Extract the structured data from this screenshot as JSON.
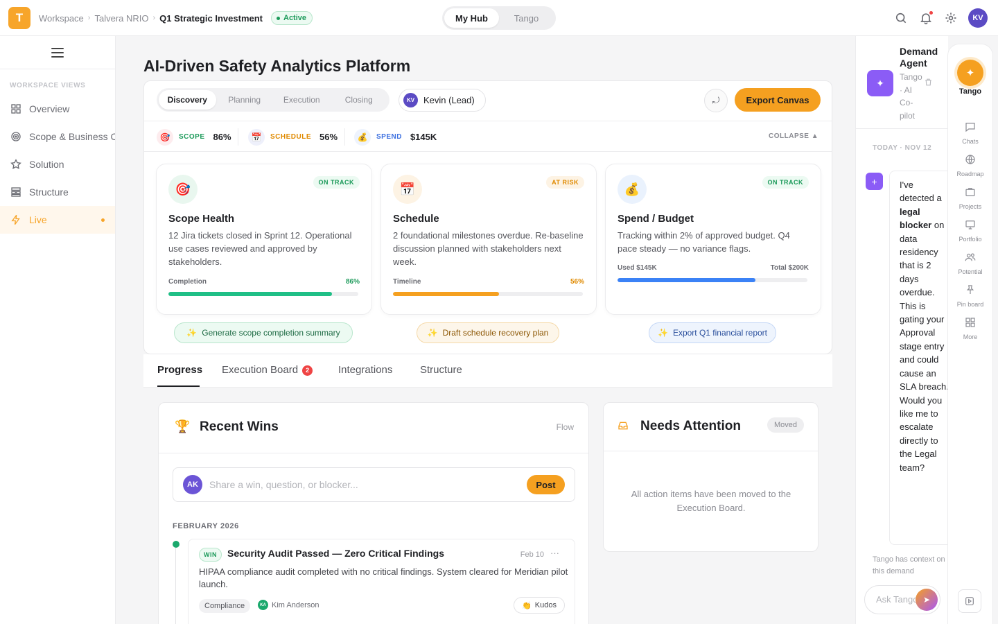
{
  "app": {
    "logo_letter": "T",
    "accent": "#f5a020"
  },
  "breadcrumb": {
    "items": [
      "Workspace",
      "Talvera NRIO"
    ],
    "current": "Q1 Strategic Investment",
    "status": "Active"
  },
  "hub": {
    "tabs": [
      "My Hub",
      "Tango"
    ],
    "active": "My Hub"
  },
  "topbar": {
    "icons": [
      "search-icon",
      "bell-icon",
      "gear-icon"
    ],
    "user_initials": "KV"
  },
  "sidebar": {
    "heading": "WORKSPACE VIEWS",
    "items": [
      {
        "label": "Overview",
        "icon": "grid-icon"
      },
      {
        "label": "Scope & Business Case",
        "icon": "target-icon"
      },
      {
        "label": "Solution",
        "icon": "star-icon"
      },
      {
        "label": "Structure",
        "icon": "structure-icon"
      },
      {
        "label": "Live",
        "icon": "bolt-icon",
        "active": true
      }
    ]
  },
  "main": {
    "title": "AI-Driven Safety Analytics Platform",
    "phases": [
      "Discovery",
      "Planning",
      "Execution",
      "Closing"
    ],
    "active_phase": "Discovery",
    "lead": {
      "initials": "KV",
      "label": "Kevin (Lead)"
    },
    "export_label": "Export Canvas",
    "collapse_label": "COLLAPSE ▲",
    "metrics": [
      {
        "label": "SCOPE",
        "value": "86%",
        "color": "#1c9a5a"
      },
      {
        "label": "SCHEDULE",
        "value": "56%",
        "color": "#e08a00"
      },
      {
        "label": "SPEND",
        "value": "$145K",
        "color": "#3b6fe0"
      }
    ],
    "cards": [
      {
        "title": "Scope Health",
        "status": "ON TRACK",
        "desc": "12 Jira tickets closed in Sprint 12. Operational use cases reviewed and approved by stakeholders.",
        "bar_label": "Completion",
        "bar_value": "86%",
        "progress": 0.86,
        "color": "#1fbf86"
      },
      {
        "title": "Schedule",
        "status": "AT RISK",
        "desc": "2 foundational milestones overdue. Re-baseline discussion planned with stakeholders next week.",
        "bar_label": "Timeline",
        "bar_value": "56%",
        "progress": 0.56,
        "color": "#f5a020"
      },
      {
        "title": "Spend / Budget",
        "status": "ON TRACK",
        "desc": "Tracking within 2% of approved budget. Q4 pace steady — no variance flags.",
        "bar_label": "Used $145K",
        "bar_value": "Total $200K",
        "progress": 0.725,
        "color": "#3b82f6"
      }
    ],
    "ai_actions": [
      "Generate scope completion summary",
      "Draft schedule recovery plan",
      "Export Q1 financial report"
    ],
    "tabs": [
      "Progress",
      "Execution Board",
      "Integrations",
      "Structure"
    ],
    "execution_board_count": "2",
    "wins": {
      "title": "Recent Wins",
      "flow": "Flow",
      "composer": {
        "initials": "AK",
        "placeholder": "Share a win, question, or blocker...",
        "post": "Post"
      },
      "month": "FEBRUARY 2026",
      "items": [
        {
          "badge": "WIN",
          "title": "Security Audit Passed — Zero Critical Findings",
          "date": "Feb 10",
          "menu": "···",
          "desc": "HIPAA compliance audit completed with no critical findings. System cleared for Meridian pilot launch.",
          "tag": "Compliance",
          "author_initials": "KA",
          "author": "Kim Anderson",
          "kudos": "Kudos"
        }
      ]
    },
    "attention": {
      "title": "Needs Attention",
      "badge": "Moved",
      "empty": "All action items have been moved to the Execution Board."
    }
  },
  "assistant": {
    "title": "Demand Agent",
    "subtitle": "Tango · AI Co-pilot",
    "date": "TODAY · NOV 12",
    "message_parts": [
      "I've detected a ",
      "legal blocker",
      " on data residency that is 2 days overdue. This is gating your Approval stage entry and could cause an SLA breach. Would you like me to escalate directly to the Legal team?"
    ],
    "context": "Tango has context on this demand",
    "input_placeholder": "Ask Tango..."
  },
  "rail": {
    "main": "Tango",
    "items": [
      {
        "label": "Chats",
        "icon": "chat-icon"
      },
      {
        "label": "Roadmap",
        "icon": "globe-icon"
      },
      {
        "label": "Projects",
        "icon": "briefcase-icon"
      },
      {
        "label": "Portfolio",
        "icon": "monitor-icon"
      },
      {
        "label": "Potential",
        "icon": "users-icon"
      },
      {
        "label": "Pin board",
        "icon": "pin-icon"
      },
      {
        "label": "More",
        "icon": "grid-icon"
      }
    ]
  }
}
